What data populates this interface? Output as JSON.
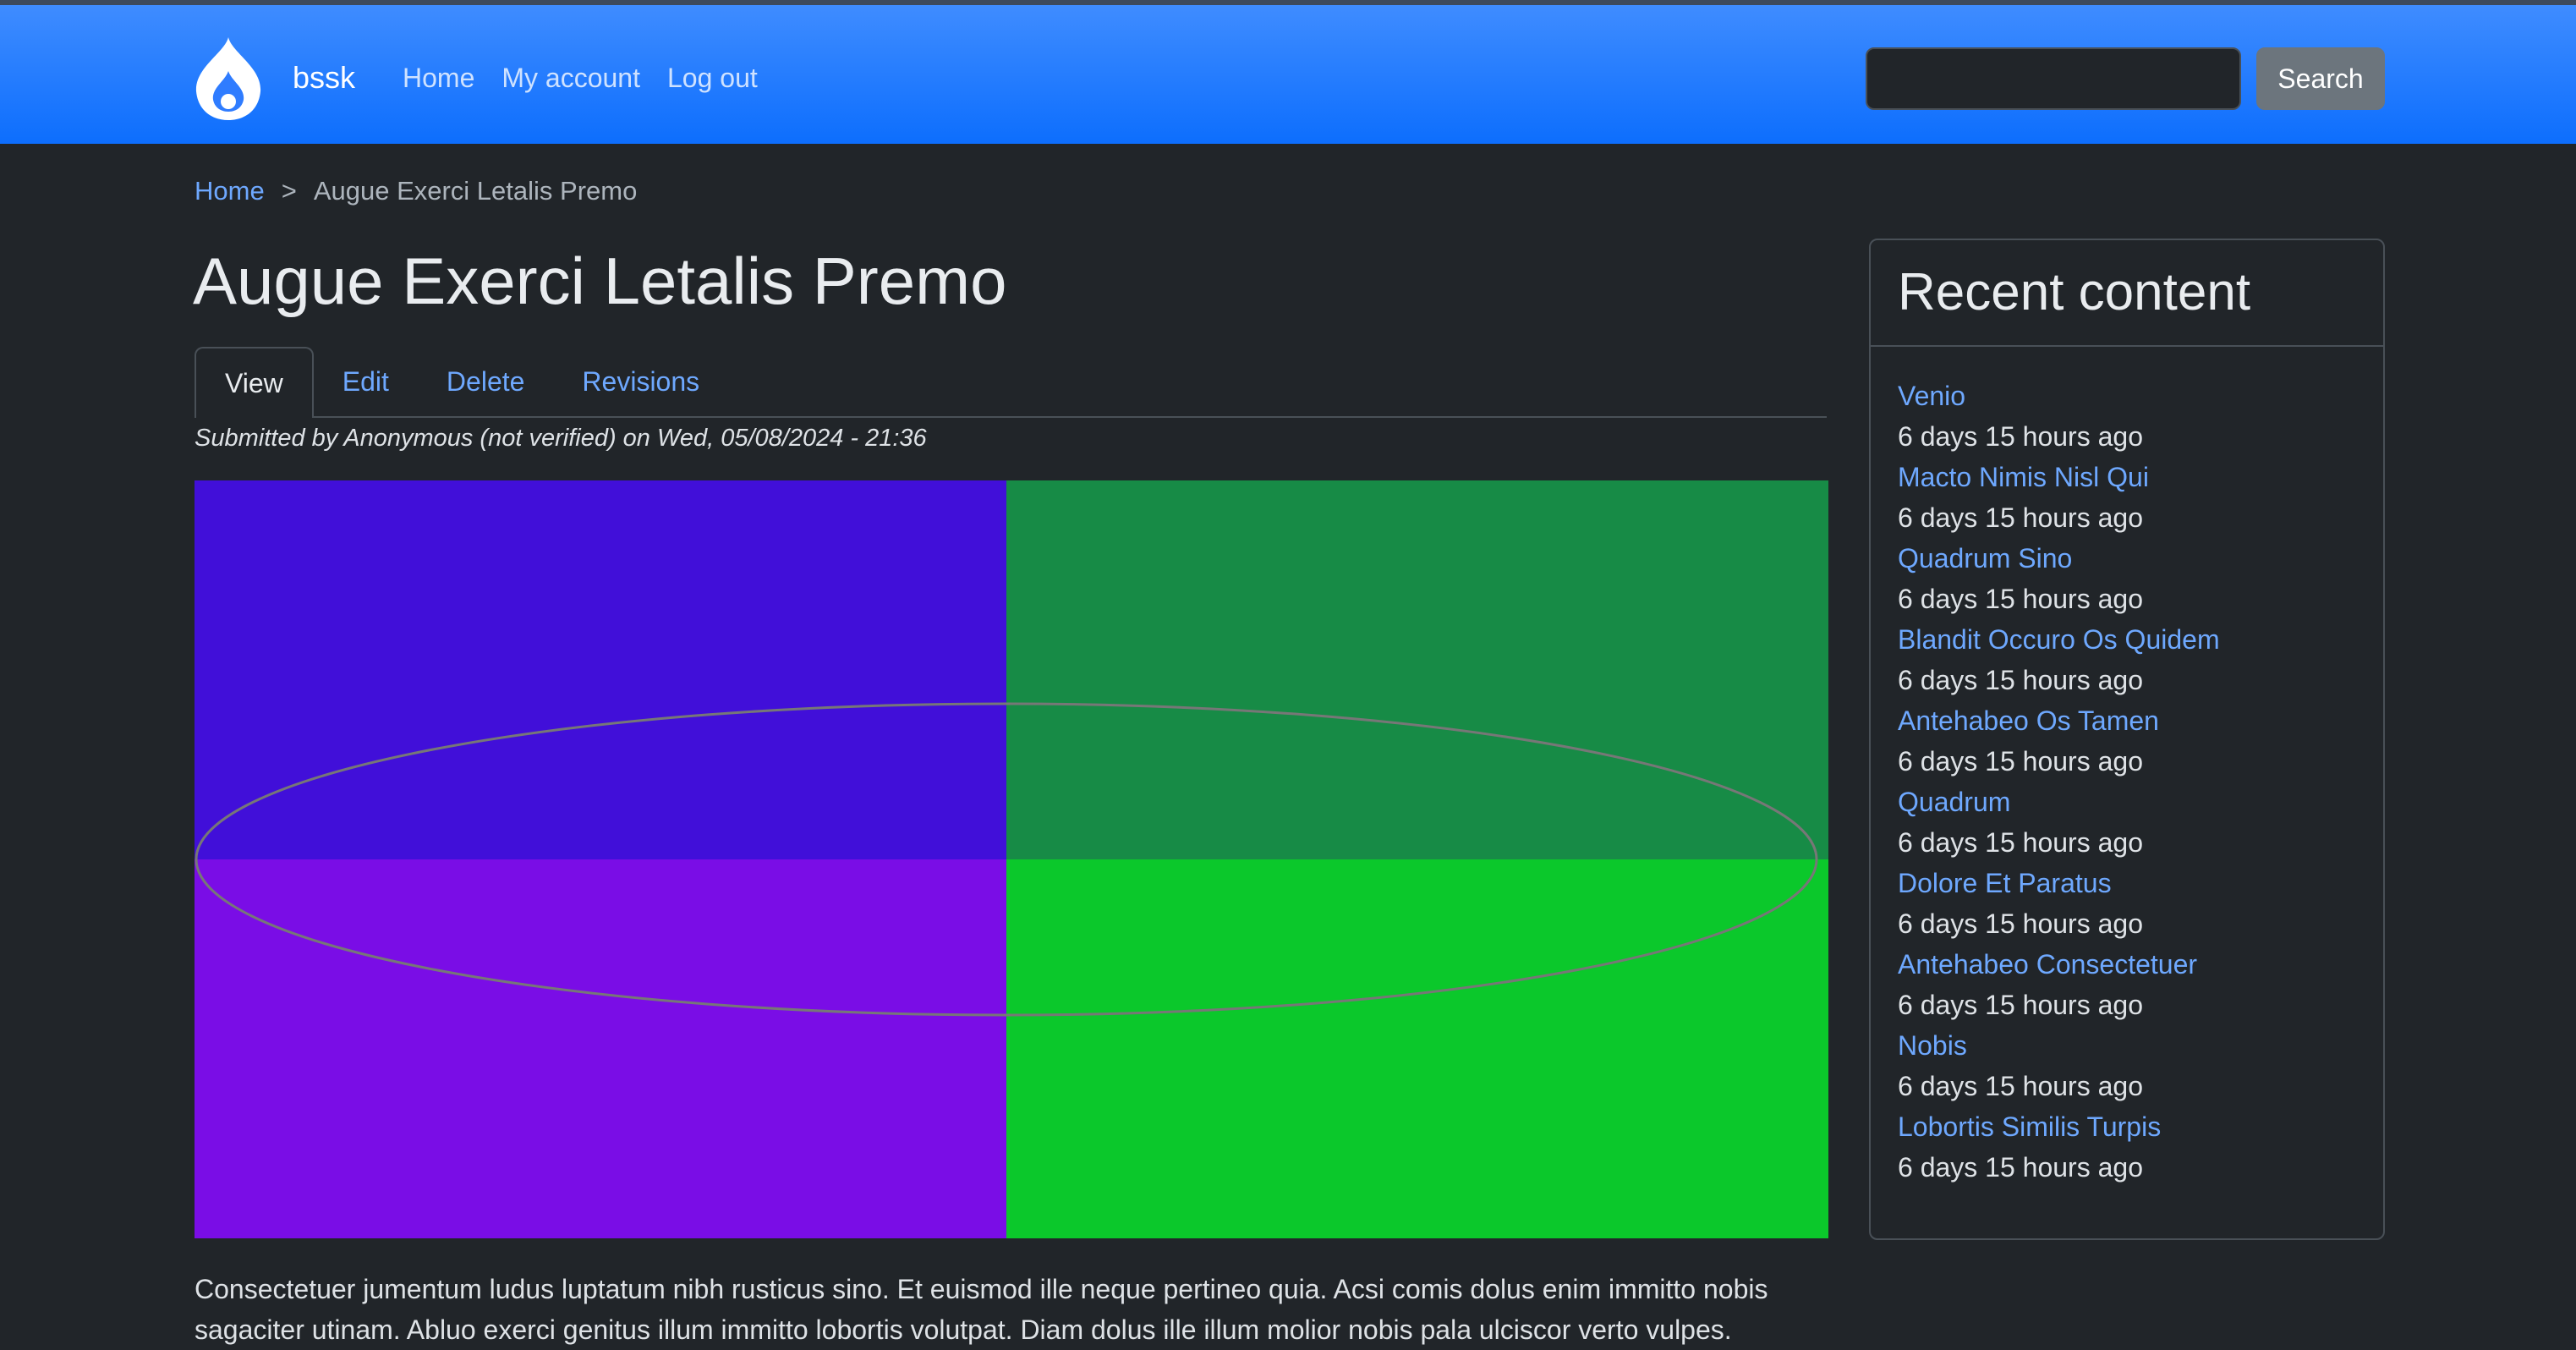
{
  "header": {
    "site_name": "bssk",
    "nav": [
      "Home",
      "My account",
      "Log out"
    ],
    "search": {
      "value": "",
      "button_label": "Search"
    }
  },
  "breadcrumb": {
    "home": "Home",
    "separator": ">",
    "current": "Augue Exerci Letalis Premo"
  },
  "page": {
    "title": "Augue Exerci Letalis Premo",
    "tabs": [
      "View",
      "Edit",
      "Delete",
      "Revisions"
    ],
    "active_tab": "View",
    "submitted": "Submitted by Anonymous (not verified) on Wed, 05/08/2024 - 21:36",
    "image_colors": {
      "top_left": "#410fd9",
      "top_right": "#178b46",
      "bottom_left": "#7a0de6",
      "bottom_right": "#0bc82b",
      "ellipse": "#777777"
    },
    "body": "Consectetuer jumentum ludus luptatum nibh rusticus sino. Et euismod ille neque pertineo quia. Acsi comis dolus enim immitto nobis sagaciter utinam. Abluo exerci genitus illum immitto lobortis volutpat. Diam dolus ille illum molior nobis pala ulciscor verto vulpes."
  },
  "sidebar": {
    "title": "Recent content",
    "items": [
      {
        "title": "Venio",
        "time": "6 days 15 hours ago"
      },
      {
        "title": "Macto Nimis Nisl Qui",
        "time": "6 days 15 hours ago"
      },
      {
        "title": "Quadrum Sino",
        "time": "6 days 15 hours ago"
      },
      {
        "title": "Blandit Occuro Os Quidem",
        "time": "6 days 15 hours ago"
      },
      {
        "title": "Antehabeo Os Tamen",
        "time": "6 days 15 hours ago"
      },
      {
        "title": "Quadrum",
        "time": "6 days 15 hours ago"
      },
      {
        "title": "Dolore Et Paratus",
        "time": "6 days 15 hours ago"
      },
      {
        "title": "Antehabeo Consectetuer",
        "time": "6 days 15 hours ago"
      },
      {
        "title": "Nobis",
        "time": "6 days 15 hours ago"
      },
      {
        "title": "Lobortis Similis Turpis",
        "time": "6 days 15 hours ago"
      }
    ]
  }
}
